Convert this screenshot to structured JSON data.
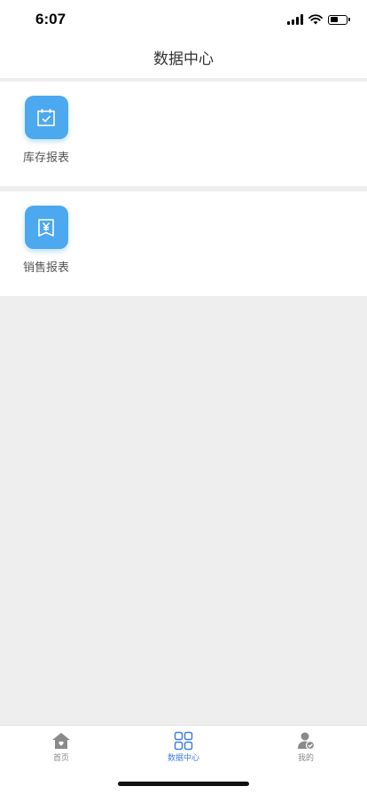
{
  "status_bar": {
    "time": "6:07"
  },
  "nav": {
    "title": "数据中心"
  },
  "sections": [
    {
      "label": "库存报表",
      "icon": "calendar-check-icon"
    },
    {
      "label": "销售报表",
      "icon": "yen-receipt-icon"
    }
  ],
  "tabbar": {
    "home": {
      "label": "首页",
      "icon": "home-icon"
    },
    "data": {
      "label": "数据中心",
      "icon": "grid-icon"
    },
    "me": {
      "label": "我的",
      "icon": "user-check-icon"
    }
  },
  "colors": {
    "accent": "#4ca8ef",
    "active_tab": "#3f7fd8",
    "background": "#eeeeee"
  }
}
